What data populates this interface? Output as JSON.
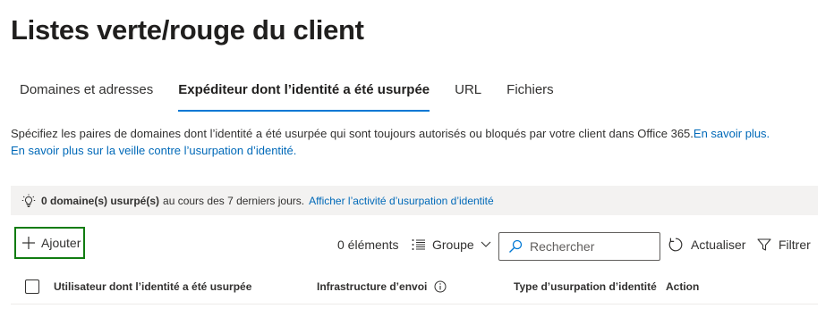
{
  "page": {
    "title": "Listes verte/rouge du client"
  },
  "tabs": [
    {
      "label": "Domaines et adresses",
      "active": false
    },
    {
      "label": "Expéditeur dont l’identité a été usurpée",
      "active": true
    },
    {
      "label": "URL",
      "active": false
    },
    {
      "label": "Fichiers",
      "active": false
    }
  ],
  "description": {
    "text": "Spécifiez les paires de domaines dont l’identité a été usurpée qui sont toujours autorisés ou bloqués par votre client dans Office 365.",
    "learn_more_link": "En savoir plus.",
    "spoof_intel_link": "En savoir plus sur la veille contre l’usurpation d’identité."
  },
  "infobar": {
    "icon": "lightbulb-icon",
    "count_bold": "0 domaine(s) usurpé(s)",
    "text": "au cours des 7 derniers jours.",
    "link": "Afficher l’activité d’usurpation d’identité"
  },
  "toolbar": {
    "add_label": "Ajouter",
    "item_count": "0 éléments",
    "group_label": "Groupe",
    "search_placeholder": "Rechercher",
    "refresh_label": "Actualiser",
    "filter_label": "Filtrer"
  },
  "table": {
    "columns": [
      "Utilisateur dont l’identité a été usurpée",
      "Infrastructure d’envoi",
      "Type d’usurpation d’identité",
      "Action"
    ]
  },
  "colors": {
    "accent": "#0078d4",
    "link": "#0069b8",
    "add_button_border": "#107c10",
    "infobar_bg": "#f3f2f1"
  }
}
